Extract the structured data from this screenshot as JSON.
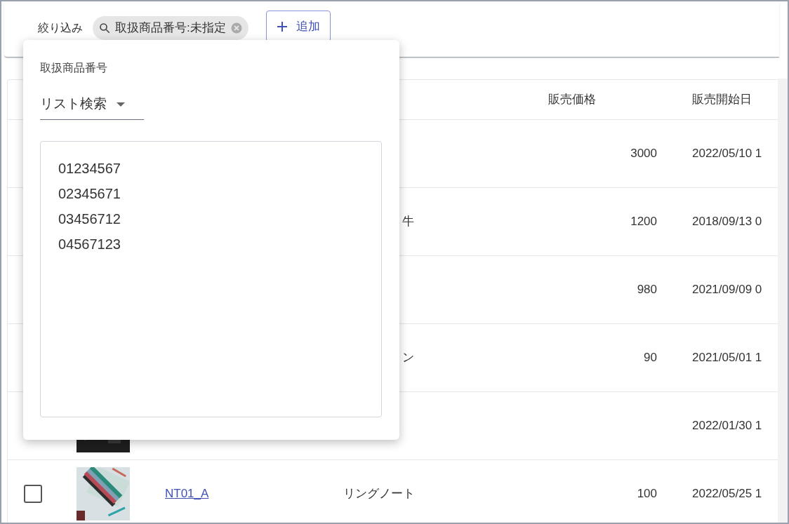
{
  "filter_bar": {
    "label": "絞り込み",
    "chip": {
      "text": "取扱商品番号:未指定"
    },
    "add_button": {
      "label": "追加"
    }
  },
  "table": {
    "columns": [
      "販売価格",
      "販売開始日"
    ],
    "rows": [
      {
        "kind": "covered",
        "price": "3000",
        "date": "2022/05/10 1"
      },
      {
        "kind": "covered",
        "name": "牛",
        "price": "1200",
        "date": "2018/09/13 0"
      },
      {
        "kind": "covered",
        "price": "980",
        "date": "2021/09/09 0"
      },
      {
        "kind": "covered",
        "name": "ン",
        "price": "90",
        "date": "2021/05/01 1"
      },
      {
        "kind": "covered",
        "date": "2022/01/30 1"
      },
      {
        "kind": "full",
        "checked": false,
        "code": "NT01_A",
        "name": "リングノート",
        "price": "100",
        "date": "2022/05/25 1"
      }
    ]
  },
  "popup": {
    "title": "取扱商品番号",
    "select": {
      "value": "リスト検索"
    },
    "textarea": {
      "value": "01234567\n02345671\n03456712\n04567123"
    }
  }
}
